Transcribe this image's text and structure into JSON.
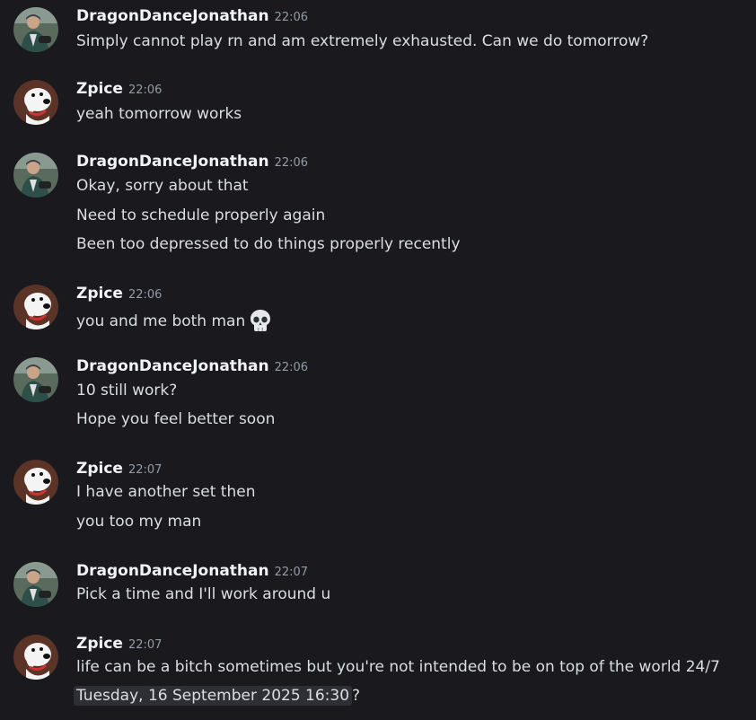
{
  "users": {
    "jonathan": "DragonDanceJonathan",
    "zpice": "Zpice"
  },
  "messages": [
    {
      "user": "DragonDanceJonathan",
      "time": "22:06",
      "lines": [
        "Simply cannot play rn and am extremely exhausted. Can we do tomorrow?"
      ]
    },
    {
      "user": "Zpice",
      "time": "22:06",
      "lines": [
        "yeah tomorrow works"
      ]
    },
    {
      "user": "DragonDanceJonathan",
      "time": "22:06",
      "lines": [
        "Okay, sorry about that",
        "Need to schedule properly again",
        "Been too depressed to do things properly recently"
      ]
    },
    {
      "user": "Zpice",
      "time": "22:06",
      "lines": [
        "you and me both man"
      ],
      "emoji": "skull-emoji"
    },
    {
      "user": "DragonDanceJonathan",
      "time": "22:06",
      "lines": [
        "10 still work?",
        "Hope you feel better soon"
      ]
    },
    {
      "user": "Zpice",
      "time": "22:07",
      "lines": [
        "I have another set then",
        "you too my man"
      ]
    },
    {
      "user": "DragonDanceJonathan",
      "time": "22:07",
      "lines": [
        "Pick a time and I'll work around u"
      ]
    },
    {
      "user": "Zpice",
      "time": "22:07",
      "lines": [
        "life can be a bitch sometimes but you're not intended to be on top of the world 24/7"
      ],
      "timestamp_chip": "Tuesday, 16 September 2025 16:30",
      "timestamp_chip_suffix": "?"
    }
  ],
  "colors": {
    "background": "#1a1a1e",
    "username": "#f2f3f5",
    "message_text": "#dbdee1",
    "timestamp": "#949ba4",
    "date_chip_bg": "#2e2f35"
  }
}
